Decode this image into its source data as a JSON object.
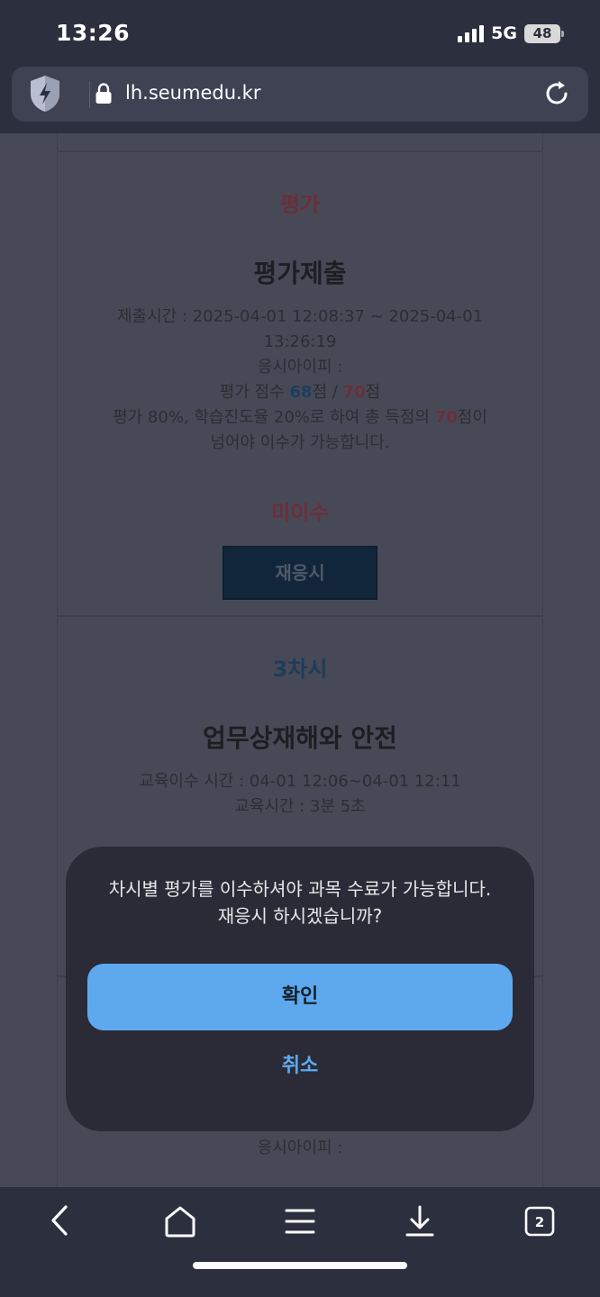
{
  "status_bar": {
    "time": "13:26",
    "network": "5G",
    "battery": "48"
  },
  "browser": {
    "url": "lh.seumedu.kr",
    "tab_count": "2"
  },
  "evaluation_card": {
    "section_label": "평가",
    "title": "평가제출",
    "submit_time_line1": "제출시간 : 2025-04-01 12:08:37 ~ 2025-04-01",
    "submit_time_line2": "13:26:19",
    "ip_label": "응시아이피 :",
    "score_prefix": "평가 점수 ",
    "score_value": "68",
    "score_mid": "점 / ",
    "score_max": "70",
    "score_suffix": "점",
    "criteria_prefix": "평가 80%, 학습진도율 20%로 하여 총 득점의 ",
    "criteria_value": "70",
    "criteria_suffix": "점이",
    "criteria_line2": "넘어야 이수가 가능합니다.",
    "status": "미이수",
    "retry_button": "재응시"
  },
  "session_card": {
    "section_label": "3차시",
    "title": "업무상재해와 안전",
    "completion_time": "교육이수 시간 : 04-01 12:06~04-01 12:11",
    "duration": "교육시간 : 3분 5초"
  },
  "bottom_card": {
    "ip_label": "응시아이피 :"
  },
  "modal": {
    "message_line1": "차시별 평가를 이수하셔야 과목 수료가 가능합니다.",
    "message_line2": "재응시 하시겠습니까?",
    "confirm": "확인",
    "cancel": "취소"
  },
  "colors": {
    "accent": "#5ea9ee",
    "modal_bg": "#2a2b36",
    "toolbar_bg": "#2c2f3d"
  }
}
